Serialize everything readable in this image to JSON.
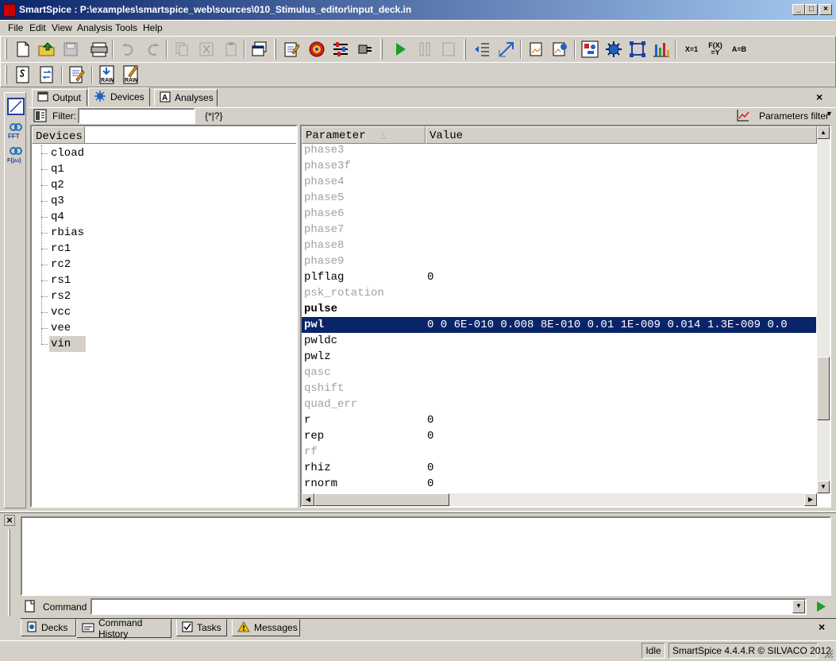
{
  "window": {
    "title": "SmartSpice : P:\\examples\\smartspice_web\\sources\\010_Stimulus_editor\\input_deck.in",
    "minimize": "_",
    "maximize": "□",
    "close": "×"
  },
  "menu": [
    "File",
    "Edit",
    "View",
    "Analysis",
    "Tools",
    "Help"
  ],
  "toolbar_math": {
    "xeq": "X=1",
    "fx": "F(X)\n=Y",
    "aeqb": "A=B"
  },
  "tabs": [
    {
      "label": "Output",
      "icon": "output-window-icon"
    },
    {
      "label": "Devices",
      "icon": "devices-icon"
    },
    {
      "label": "Analyses",
      "icon": "analyses-icon"
    }
  ],
  "active_tab": "Devices",
  "filter": {
    "label": "Filter:",
    "value": "",
    "hint": "{*|?}"
  },
  "params_filter": {
    "label": "Parameters filter"
  },
  "devices": {
    "header": "Devices",
    "items": [
      "cload",
      "q1",
      "q2",
      "q3",
      "q4",
      "rbias",
      "rc1",
      "rc2",
      "rs1",
      "rs2",
      "vcc",
      "vee",
      "vin"
    ],
    "selected": "vin"
  },
  "params": {
    "header_name": "Parameter",
    "header_value": "Value",
    "rows": [
      {
        "name": "phase3",
        "value": "",
        "style": "gray"
      },
      {
        "name": "phase3f",
        "value": "",
        "style": "gray"
      },
      {
        "name": "phase4",
        "value": "",
        "style": "gray"
      },
      {
        "name": "phase5",
        "value": "",
        "style": "gray"
      },
      {
        "name": "phase6",
        "value": "",
        "style": "gray"
      },
      {
        "name": "phase7",
        "value": "",
        "style": "gray"
      },
      {
        "name": "phase8",
        "value": "",
        "style": "gray"
      },
      {
        "name": "phase9",
        "value": "",
        "style": "gray"
      },
      {
        "name": "plflag",
        "value": "0",
        "style": "normal"
      },
      {
        "name": "psk_rotation",
        "value": "",
        "style": "gray"
      },
      {
        "name": "pulse",
        "value": "",
        "style": "bold"
      },
      {
        "name": "pwl",
        "value": "0 0 6E-010 0.008 8E-010 0.01 1E-009 0.014 1.3E-009 0.0",
        "style": "selected"
      },
      {
        "name": "pwldc",
        "value": "",
        "style": "normal"
      },
      {
        "name": "pwlz",
        "value": "",
        "style": "normal"
      },
      {
        "name": "qasc",
        "value": "",
        "style": "gray"
      },
      {
        "name": "qshift",
        "value": "",
        "style": "gray"
      },
      {
        "name": "quad_err",
        "value": "",
        "style": "gray"
      },
      {
        "name": "r",
        "value": "0",
        "style": "normal"
      },
      {
        "name": "rep",
        "value": "0",
        "style": "normal"
      },
      {
        "name": "rf",
        "value": "",
        "style": "gray"
      },
      {
        "name": "rhiz",
        "value": "0",
        "style": "normal"
      },
      {
        "name": "rnorm",
        "value": "0",
        "style": "normal"
      }
    ]
  },
  "command": {
    "label": "Command :",
    "value": ""
  },
  "bottom_tabs": [
    {
      "label": "Decks",
      "icon": "decks-icon"
    },
    {
      "label": "Command History",
      "icon": "command-history-icon"
    },
    {
      "label": "Tasks",
      "icon": "tasks-icon"
    },
    {
      "label": "Messages",
      "icon": "warning-icon"
    }
  ],
  "active_bottom_tab": "Command History",
  "status": {
    "state": "Idle",
    "version": "SmartSpice 4.4.4.R © SILVACO 2012"
  },
  "colors": {
    "selection": "#0a246a",
    "title_start": "#0a246a",
    "title_end": "#a6caf0",
    "face": "#d4d0c8",
    "run_green": "#1a9e2a"
  }
}
